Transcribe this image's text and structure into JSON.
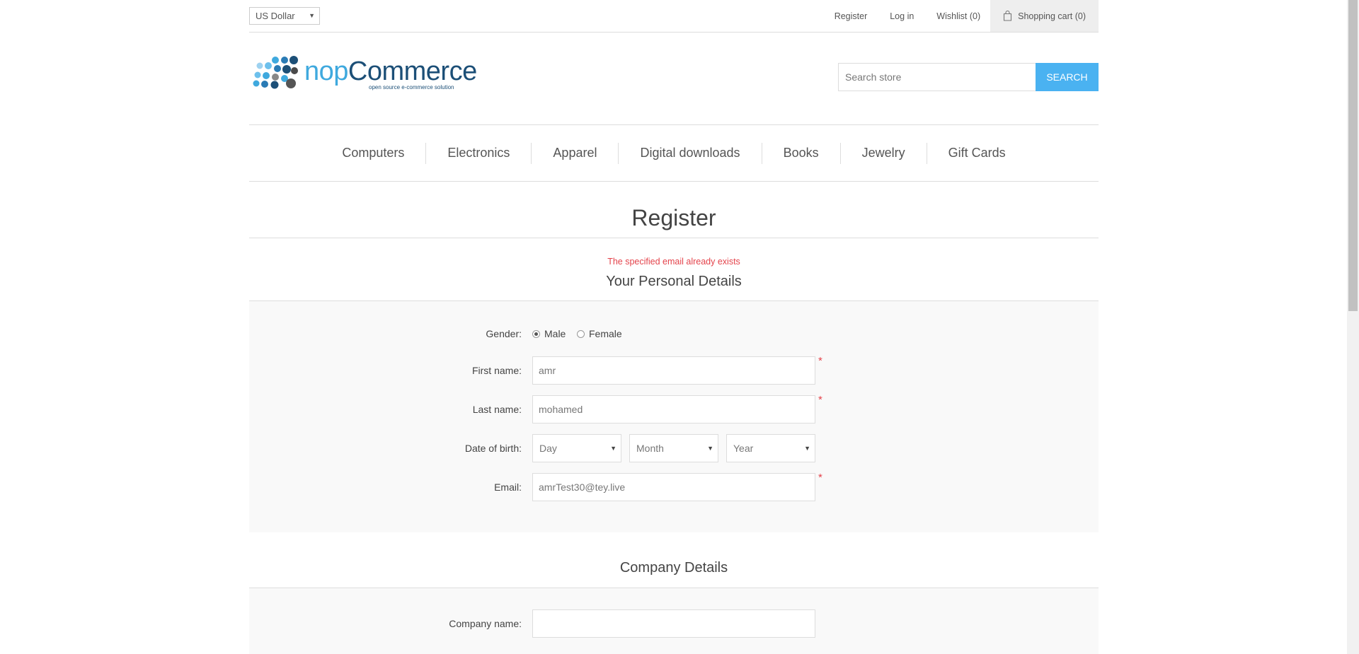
{
  "header": {
    "currency": "US Dollar",
    "links": {
      "register": "Register",
      "login": "Log in",
      "wishlist": "Wishlist (0)",
      "cart": "Shopping cart (0)"
    }
  },
  "logo": {
    "word_part1": "nop",
    "word_part2": "Commerce",
    "tagline": "open source e-commerce solution"
  },
  "search": {
    "placeholder": "Search store",
    "button": "Search"
  },
  "menu": [
    "Computers",
    "Electronics",
    "Apparel",
    "Digital downloads",
    "Books",
    "Jewelry",
    "Gift Cards"
  ],
  "page": {
    "title": "Register",
    "error": "The specified email already exists"
  },
  "personal": {
    "title": "Your Personal Details",
    "gender_label": "Gender:",
    "gender_male": "Male",
    "gender_female": "Female",
    "gender_selected": "Male",
    "first_name_label": "First name:",
    "first_name_value": "amr",
    "last_name_label": "Last name:",
    "last_name_value": "mohamed",
    "dob_label": "Date of birth:",
    "dob_day": "Day",
    "dob_month": "Month",
    "dob_year": "Year",
    "email_label": "Email:",
    "email_value": "amrTest30@tey.live",
    "required_mark": "*"
  },
  "company": {
    "title": "Company Details",
    "name_label": "Company name:",
    "name_value": ""
  },
  "colors": {
    "accent": "#4ab2f1",
    "error": "#e4434b",
    "panel": "#f9f9f9"
  }
}
